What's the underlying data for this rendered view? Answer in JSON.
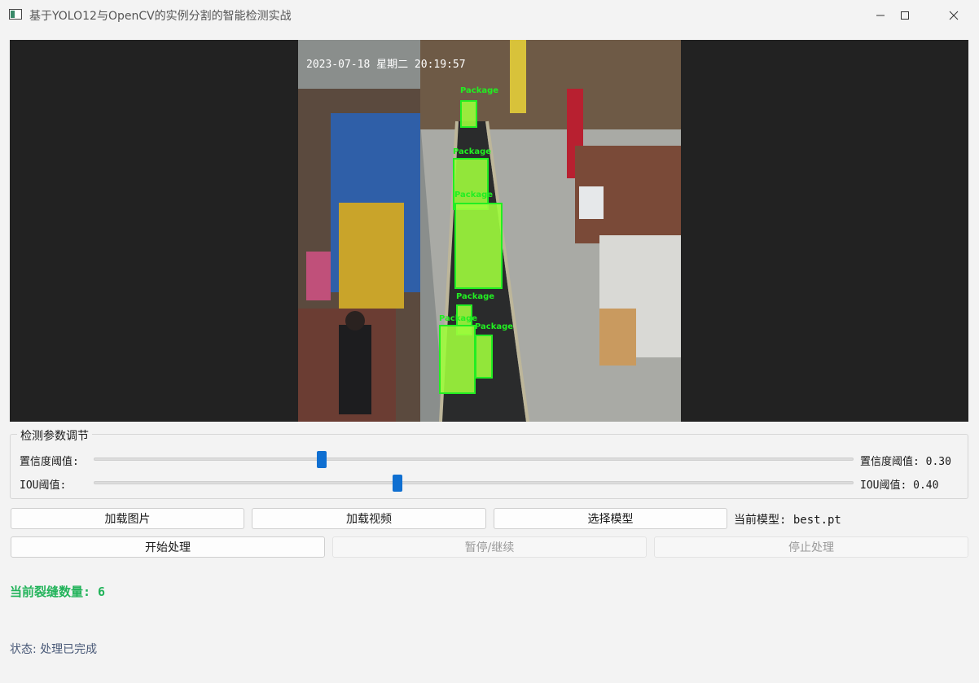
{
  "window": {
    "title": "基于YOLO12与OpenCV的实例分割的智能检测实战"
  },
  "video": {
    "overlay_timestamp": "2023-07-18 星期二 20:19:57",
    "detection_label": "Package",
    "detections": [
      {
        "label": "Package"
      },
      {
        "label": "Package"
      },
      {
        "label": "Package"
      },
      {
        "label": "Package"
      },
      {
        "label": "Package"
      },
      {
        "label": "Package"
      }
    ]
  },
  "params": {
    "group_title": "检测参数调节",
    "confidence": {
      "label": "置信度阈值:",
      "value_text": "置信度阈值: 0.30",
      "value": 0.3
    },
    "iou": {
      "label": "IOU阈值:",
      "value_text": "IOU阈值: 0.40",
      "value": 0.4
    }
  },
  "buttons": {
    "load_image": "加载图片",
    "load_video": "加载视频",
    "select_model": "选择模型",
    "start": "开始处理",
    "pause": "暂停/继续",
    "stop": "停止处理"
  },
  "model": {
    "current_text": "当前模型: best.pt"
  },
  "result": {
    "count_text": "当前裂缝数量: 6"
  },
  "status": {
    "text": "状态: 处理已完成"
  },
  "colors": {
    "accent": "#0f6fd1",
    "detection_green": "#22ee22",
    "count_green": "#22b35a",
    "status_text": "#4a5a78"
  }
}
